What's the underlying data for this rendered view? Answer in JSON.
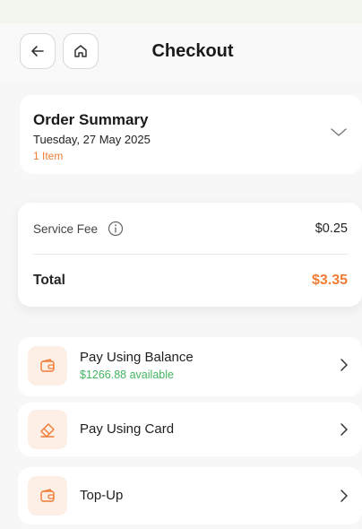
{
  "header": {
    "title": "Checkout",
    "back_icon": "arrow-left-icon",
    "home_icon": "home-icon"
  },
  "order_summary": {
    "title": "Order Summary",
    "date": "Tuesday, 27 May 2025",
    "items": "1 Item",
    "toggle_icon": "chevron-down-icon"
  },
  "fees": {
    "service_fee_label": "Service Fee",
    "service_fee_value": "$0.25",
    "total_label": "Total",
    "total_value": "$3.35",
    "info_icon": "info-icon"
  },
  "payment_options": [
    {
      "title": "Pay Using Balance",
      "subtitle": "$1266.88 available",
      "icon": "wallet-icon"
    },
    {
      "title": "Pay Using Card",
      "icon": "card-icon"
    },
    {
      "title": "Top-Up",
      "icon": "wallet-icon"
    }
  ],
  "colors": {
    "accent": "#f07c34",
    "success": "#43b561",
    "icon_bg": "#fdeee6"
  }
}
